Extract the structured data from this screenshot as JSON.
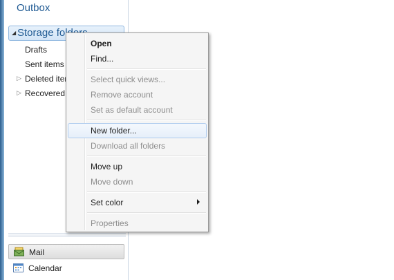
{
  "sidebar": {
    "outbox": "Outbox",
    "storage_folders": "Storage folders",
    "items": [
      {
        "label": "Drafts"
      },
      {
        "label": "Sent items"
      },
      {
        "label": "Deleted items"
      },
      {
        "label": "Recovered"
      }
    ],
    "nav": {
      "mail": "Mail",
      "calendar": "Calendar"
    }
  },
  "context_menu": {
    "open": "Open",
    "find": "Find...",
    "select_quick_views": "Select quick views...",
    "remove_account": "Remove account",
    "set_default_account": "Set as default account",
    "new_folder": "New folder...",
    "download_all_folders": "Download all folders",
    "move_up": "Move up",
    "move_down": "Move down",
    "set_color": "Set color",
    "properties": "Properties"
  }
}
